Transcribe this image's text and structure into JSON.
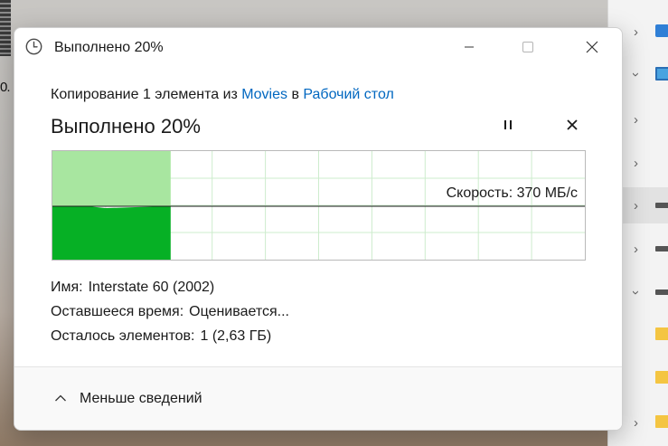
{
  "window": {
    "title": "Выполнено 20%"
  },
  "copy_line": {
    "prefix": "Копирование 1 элемента из",
    "source": "Movies",
    "joiner": "в",
    "destination": "Рабочий стол"
  },
  "progress": {
    "heading": "Выполнено 20%",
    "percent": 20,
    "speed_label": "Скорость: 370 МБ/с",
    "fill_color_done": "#06b025",
    "fill_color_remaining_area": "#a8e6a0"
  },
  "details": {
    "name_label": "Имя:",
    "name_value": "Interstate 60 (2002)",
    "time_label": "Оставшееся время:",
    "time_value": "Оценивается...",
    "items_label": "Осталось элементов:",
    "items_value": "1 (2,63 ГБ)"
  },
  "footer": {
    "less_details_label": "Меньше сведений"
  },
  "desktop": {
    "icon_label": "0."
  },
  "icons": {
    "clock": "clock-icon",
    "minimize": "minimize-icon",
    "maximize": "maximize-icon",
    "close": "close-icon",
    "pause": "pause-icon",
    "cancel": "cancel-icon",
    "chevron_up": "chevron-up-icon"
  },
  "colors": {
    "link": "#0067c0",
    "accent_green": "#06b025"
  }
}
